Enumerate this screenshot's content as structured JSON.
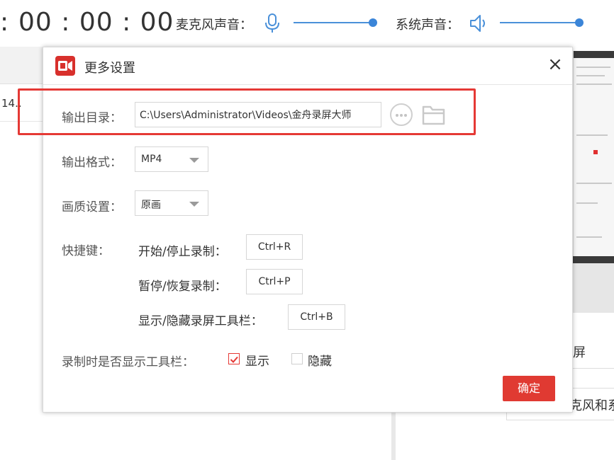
{
  "topbar": {
    "timer_prefix": ":",
    "timer": "00 : 00 : 00",
    "mic_label": "麦克风声音：",
    "system_label": "系统声音：",
    "mic_volume_percent": 100,
    "system_volume_percent": 100,
    "accent_color": "#4a90d9"
  },
  "background": {
    "left_cell_text": "14..",
    "right_text_1": "屏",
    "right_text_2": "克风和系"
  },
  "dialog": {
    "icon": "app-logo-icon",
    "title": "更多设置",
    "close_icon": "close-icon",
    "close_label": "×",
    "output_dir": {
      "label": "输出目录：",
      "value": "C:\\Users\\Administrator\\Videos\\金舟录屏大师",
      "more_icon": "more-dots-icon",
      "folder_icon": "folder-icon"
    },
    "output_format": {
      "label": "输出格式：",
      "selected": "MP4"
    },
    "quality": {
      "label": "画质设置：",
      "selected": "原画"
    },
    "hotkeys": {
      "label": "快捷键：",
      "items": [
        {
          "label": "开始/停止录制：",
          "key": "Ctrl+R"
        },
        {
          "label": "暂停/恢复录制：",
          "key": "Ctrl+P"
        },
        {
          "label": "显示/隐藏录屏工具栏：",
          "key": "Ctrl+B"
        }
      ]
    },
    "toolbar_display": {
      "label": "录制时是否显示工具栏：",
      "options": [
        {
          "label": "显示",
          "checked": true
        },
        {
          "label": "隐藏",
          "checked": false
        }
      ]
    },
    "confirm_label": "确定",
    "highlight_color": "#e53935",
    "button_color": "#e03a32"
  }
}
